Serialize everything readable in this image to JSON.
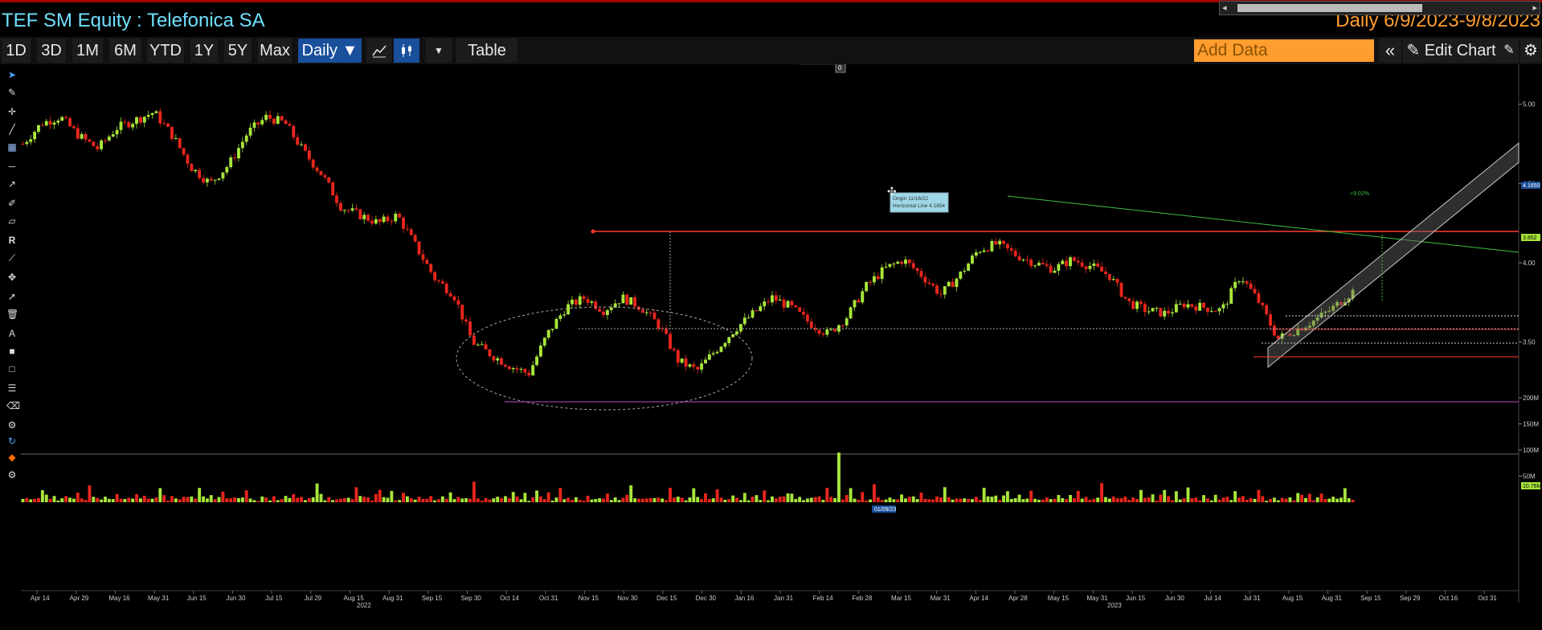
{
  "header": {
    "title": "TEF SM Equity : Telefonica SA",
    "range_label": "Daily  6/9/2023-9/8/2023"
  },
  "toolbar": {
    "periods": [
      "1D",
      "3D",
      "1M",
      "6M",
      "YTD",
      "1Y",
      "5Y",
      "Max"
    ],
    "frequency": "Daily ▼",
    "table_label": "Table",
    "add_data_placeholder": "Add Data",
    "edit_chart_label": "Edit Chart"
  },
  "icons": {
    "line_chart": "line-chart-icon",
    "candle_chart": "candlestick-icon",
    "dropdown": "chevron-down-icon",
    "collapse": "double-chevron-left-icon",
    "pencil": "pencil-icon",
    "gear": "gear-icon"
  },
  "colors": {
    "up": "#a8e63a",
    "down": "#e8261c",
    "accent": "#1a4f9c",
    "orange": "#ff9d2e",
    "hline": "#ff3b30",
    "trend": "#3fbf3f",
    "support": "#c248c2"
  },
  "chart_data": {
    "type": "candlestick",
    "price_axis": {
      "ticks": [
        "5.00",
        "4.50",
        "4.00",
        "3.50"
      ],
      "range": [
        3.25,
        5.1
      ]
    },
    "volume_axis": {
      "ticks": [
        "200M",
        "150M",
        "100M",
        "50M"
      ],
      "range": [
        0,
        200
      ]
    },
    "x_tick_labels": [
      "Apr 14",
      "Apr 29",
      "May 16",
      "May 31",
      "Jun 15",
      "Jun 30",
      "Jul 15",
      "Jul 29",
      "Aug 15",
      "Aug 31",
      "Sep 15",
      "Sep 30",
      "Oct 14",
      "Oct 31",
      "Nov 15",
      "Nov 30",
      "Dec 15",
      "Dec 30",
      "Jan 16",
      "Jan 31",
      "Feb 14",
      "Feb 28",
      "Mar 15",
      "Mar 31",
      "Apr 14",
      "Apr 28",
      "May 15",
      "May 31",
      "Jun 15",
      "Jun 30",
      "Jul 14",
      "Jul 31",
      "Aug 15",
      "Aug 31",
      "Sep 15",
      "Sep 29",
      "Oct 16",
      "Oct 31"
    ],
    "year_labels": [
      "2022",
      "2023"
    ],
    "price_path": [
      4.75,
      4.88,
      4.92,
      4.8,
      4.72,
      4.85,
      4.9,
      4.95,
      4.8,
      4.6,
      4.5,
      4.62,
      4.82,
      4.92,
      4.88,
      4.7,
      4.55,
      4.35,
      4.3,
      4.25,
      4.3,
      4.1,
      3.9,
      3.8,
      3.5,
      3.42,
      3.35,
      3.3,
      3.55,
      3.72,
      3.78,
      3.7,
      3.78,
      3.72,
      3.6,
      3.38,
      3.32,
      3.45,
      3.58,
      3.68,
      3.78,
      3.72,
      3.62,
      3.55,
      3.66,
      3.85,
      3.96,
      4.02,
      3.92,
      3.8,
      3.92,
      4.08,
      4.12,
      4.05,
      4.0,
      3.96,
      4.02,
      3.98,
      3.92,
      3.75,
      3.7,
      3.68,
      3.74,
      3.72,
      3.7,
      3.92,
      3.75,
      3.52,
      3.58,
      3.64,
      3.72,
      3.82
    ],
    "volume_baseline": [
      8,
      14,
      10,
      12,
      9,
      30,
      15,
      11,
      18,
      6,
      16,
      28,
      13,
      9,
      22,
      8,
      10,
      35,
      12,
      9,
      6,
      14,
      11,
      7,
      20,
      8,
      12,
      16,
      10,
      24,
      9,
      13,
      8,
      11,
      15,
      40,
      18,
      7,
      12,
      9
    ],
    "volume_peak_idx": 208,
    "volume_peak": 95,
    "annotations": {
      "horizontal_line_label": "Origin 11/16/22\nHorizontal Line 4.1654",
      "horizontal_line_value": 4.1654,
      "channel_pct": "+9.02%",
      "last_price": "3.852",
      "level_price": "4.1650",
      "volume_last": "10.76M",
      "date_tag": "01/09/23"
    }
  }
}
